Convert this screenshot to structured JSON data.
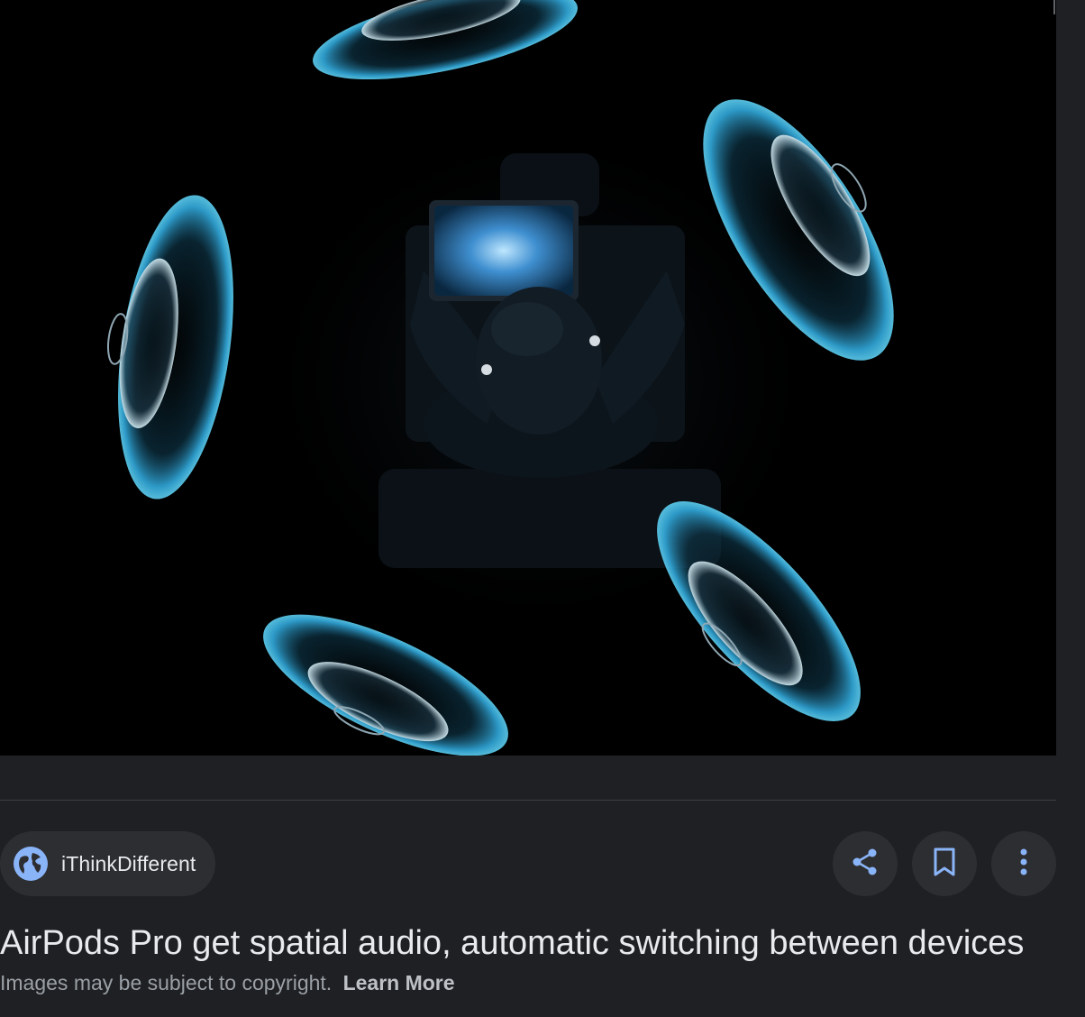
{
  "preview": {
    "image_alt": "Person watching a tablet surrounded by glowing spatial audio speaker rings"
  },
  "source": {
    "name": "iThinkDifferent",
    "icon": "globe-icon"
  },
  "actions": {
    "share_icon": "share-icon",
    "save_icon": "bookmark-icon",
    "more_icon": "more-vert-icon"
  },
  "result": {
    "title": "AirPods Pro get spatial audio, automatic switching between devices",
    "copyright_text": "Images may be subject to copyright.",
    "learn_more": "Learn More"
  },
  "colors": {
    "background": "#1f2023",
    "chip": "#2d2e31",
    "accent": "#8ab4f8",
    "text": "#e8eaed",
    "muted": "#9aa0a6",
    "ring_glow": "#3aa6d6"
  }
}
